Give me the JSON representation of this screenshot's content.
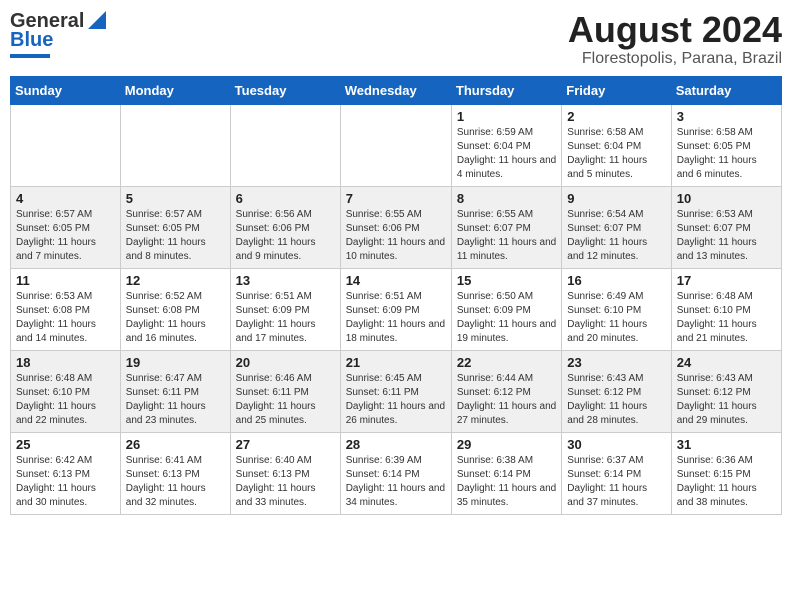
{
  "header": {
    "logo_general": "General",
    "logo_blue": "Blue",
    "month_title": "August 2024",
    "subtitle": "Florestopolis, Parana, Brazil"
  },
  "days_of_week": [
    "Sunday",
    "Monday",
    "Tuesday",
    "Wednesday",
    "Thursday",
    "Friday",
    "Saturday"
  ],
  "weeks": [
    [
      {
        "day": "",
        "info": ""
      },
      {
        "day": "",
        "info": ""
      },
      {
        "day": "",
        "info": ""
      },
      {
        "day": "",
        "info": ""
      },
      {
        "day": "1",
        "info": "Sunrise: 6:59 AM\nSunset: 6:04 PM\nDaylight: 11 hours and 4 minutes."
      },
      {
        "day": "2",
        "info": "Sunrise: 6:58 AM\nSunset: 6:04 PM\nDaylight: 11 hours and 5 minutes."
      },
      {
        "day": "3",
        "info": "Sunrise: 6:58 AM\nSunset: 6:05 PM\nDaylight: 11 hours and 6 minutes."
      }
    ],
    [
      {
        "day": "4",
        "info": "Sunrise: 6:57 AM\nSunset: 6:05 PM\nDaylight: 11 hours and 7 minutes."
      },
      {
        "day": "5",
        "info": "Sunrise: 6:57 AM\nSunset: 6:05 PM\nDaylight: 11 hours and 8 minutes."
      },
      {
        "day": "6",
        "info": "Sunrise: 6:56 AM\nSunset: 6:06 PM\nDaylight: 11 hours and 9 minutes."
      },
      {
        "day": "7",
        "info": "Sunrise: 6:55 AM\nSunset: 6:06 PM\nDaylight: 11 hours and 10 minutes."
      },
      {
        "day": "8",
        "info": "Sunrise: 6:55 AM\nSunset: 6:07 PM\nDaylight: 11 hours and 11 minutes."
      },
      {
        "day": "9",
        "info": "Sunrise: 6:54 AM\nSunset: 6:07 PM\nDaylight: 11 hours and 12 minutes."
      },
      {
        "day": "10",
        "info": "Sunrise: 6:53 AM\nSunset: 6:07 PM\nDaylight: 11 hours and 13 minutes."
      }
    ],
    [
      {
        "day": "11",
        "info": "Sunrise: 6:53 AM\nSunset: 6:08 PM\nDaylight: 11 hours and 14 minutes."
      },
      {
        "day": "12",
        "info": "Sunrise: 6:52 AM\nSunset: 6:08 PM\nDaylight: 11 hours and 16 minutes."
      },
      {
        "day": "13",
        "info": "Sunrise: 6:51 AM\nSunset: 6:09 PM\nDaylight: 11 hours and 17 minutes."
      },
      {
        "day": "14",
        "info": "Sunrise: 6:51 AM\nSunset: 6:09 PM\nDaylight: 11 hours and 18 minutes."
      },
      {
        "day": "15",
        "info": "Sunrise: 6:50 AM\nSunset: 6:09 PM\nDaylight: 11 hours and 19 minutes."
      },
      {
        "day": "16",
        "info": "Sunrise: 6:49 AM\nSunset: 6:10 PM\nDaylight: 11 hours and 20 minutes."
      },
      {
        "day": "17",
        "info": "Sunrise: 6:48 AM\nSunset: 6:10 PM\nDaylight: 11 hours and 21 minutes."
      }
    ],
    [
      {
        "day": "18",
        "info": "Sunrise: 6:48 AM\nSunset: 6:10 PM\nDaylight: 11 hours and 22 minutes."
      },
      {
        "day": "19",
        "info": "Sunrise: 6:47 AM\nSunset: 6:11 PM\nDaylight: 11 hours and 23 minutes."
      },
      {
        "day": "20",
        "info": "Sunrise: 6:46 AM\nSunset: 6:11 PM\nDaylight: 11 hours and 25 minutes."
      },
      {
        "day": "21",
        "info": "Sunrise: 6:45 AM\nSunset: 6:11 PM\nDaylight: 11 hours and 26 minutes."
      },
      {
        "day": "22",
        "info": "Sunrise: 6:44 AM\nSunset: 6:12 PM\nDaylight: 11 hours and 27 minutes."
      },
      {
        "day": "23",
        "info": "Sunrise: 6:43 AM\nSunset: 6:12 PM\nDaylight: 11 hours and 28 minutes."
      },
      {
        "day": "24",
        "info": "Sunrise: 6:43 AM\nSunset: 6:12 PM\nDaylight: 11 hours and 29 minutes."
      }
    ],
    [
      {
        "day": "25",
        "info": "Sunrise: 6:42 AM\nSunset: 6:13 PM\nDaylight: 11 hours and 30 minutes."
      },
      {
        "day": "26",
        "info": "Sunrise: 6:41 AM\nSunset: 6:13 PM\nDaylight: 11 hours and 32 minutes."
      },
      {
        "day": "27",
        "info": "Sunrise: 6:40 AM\nSunset: 6:13 PM\nDaylight: 11 hours and 33 minutes."
      },
      {
        "day": "28",
        "info": "Sunrise: 6:39 AM\nSunset: 6:14 PM\nDaylight: 11 hours and 34 minutes."
      },
      {
        "day": "29",
        "info": "Sunrise: 6:38 AM\nSunset: 6:14 PM\nDaylight: 11 hours and 35 minutes."
      },
      {
        "day": "30",
        "info": "Sunrise: 6:37 AM\nSunset: 6:14 PM\nDaylight: 11 hours and 37 minutes."
      },
      {
        "day": "31",
        "info": "Sunrise: 6:36 AM\nSunset: 6:15 PM\nDaylight: 11 hours and 38 minutes."
      }
    ]
  ]
}
